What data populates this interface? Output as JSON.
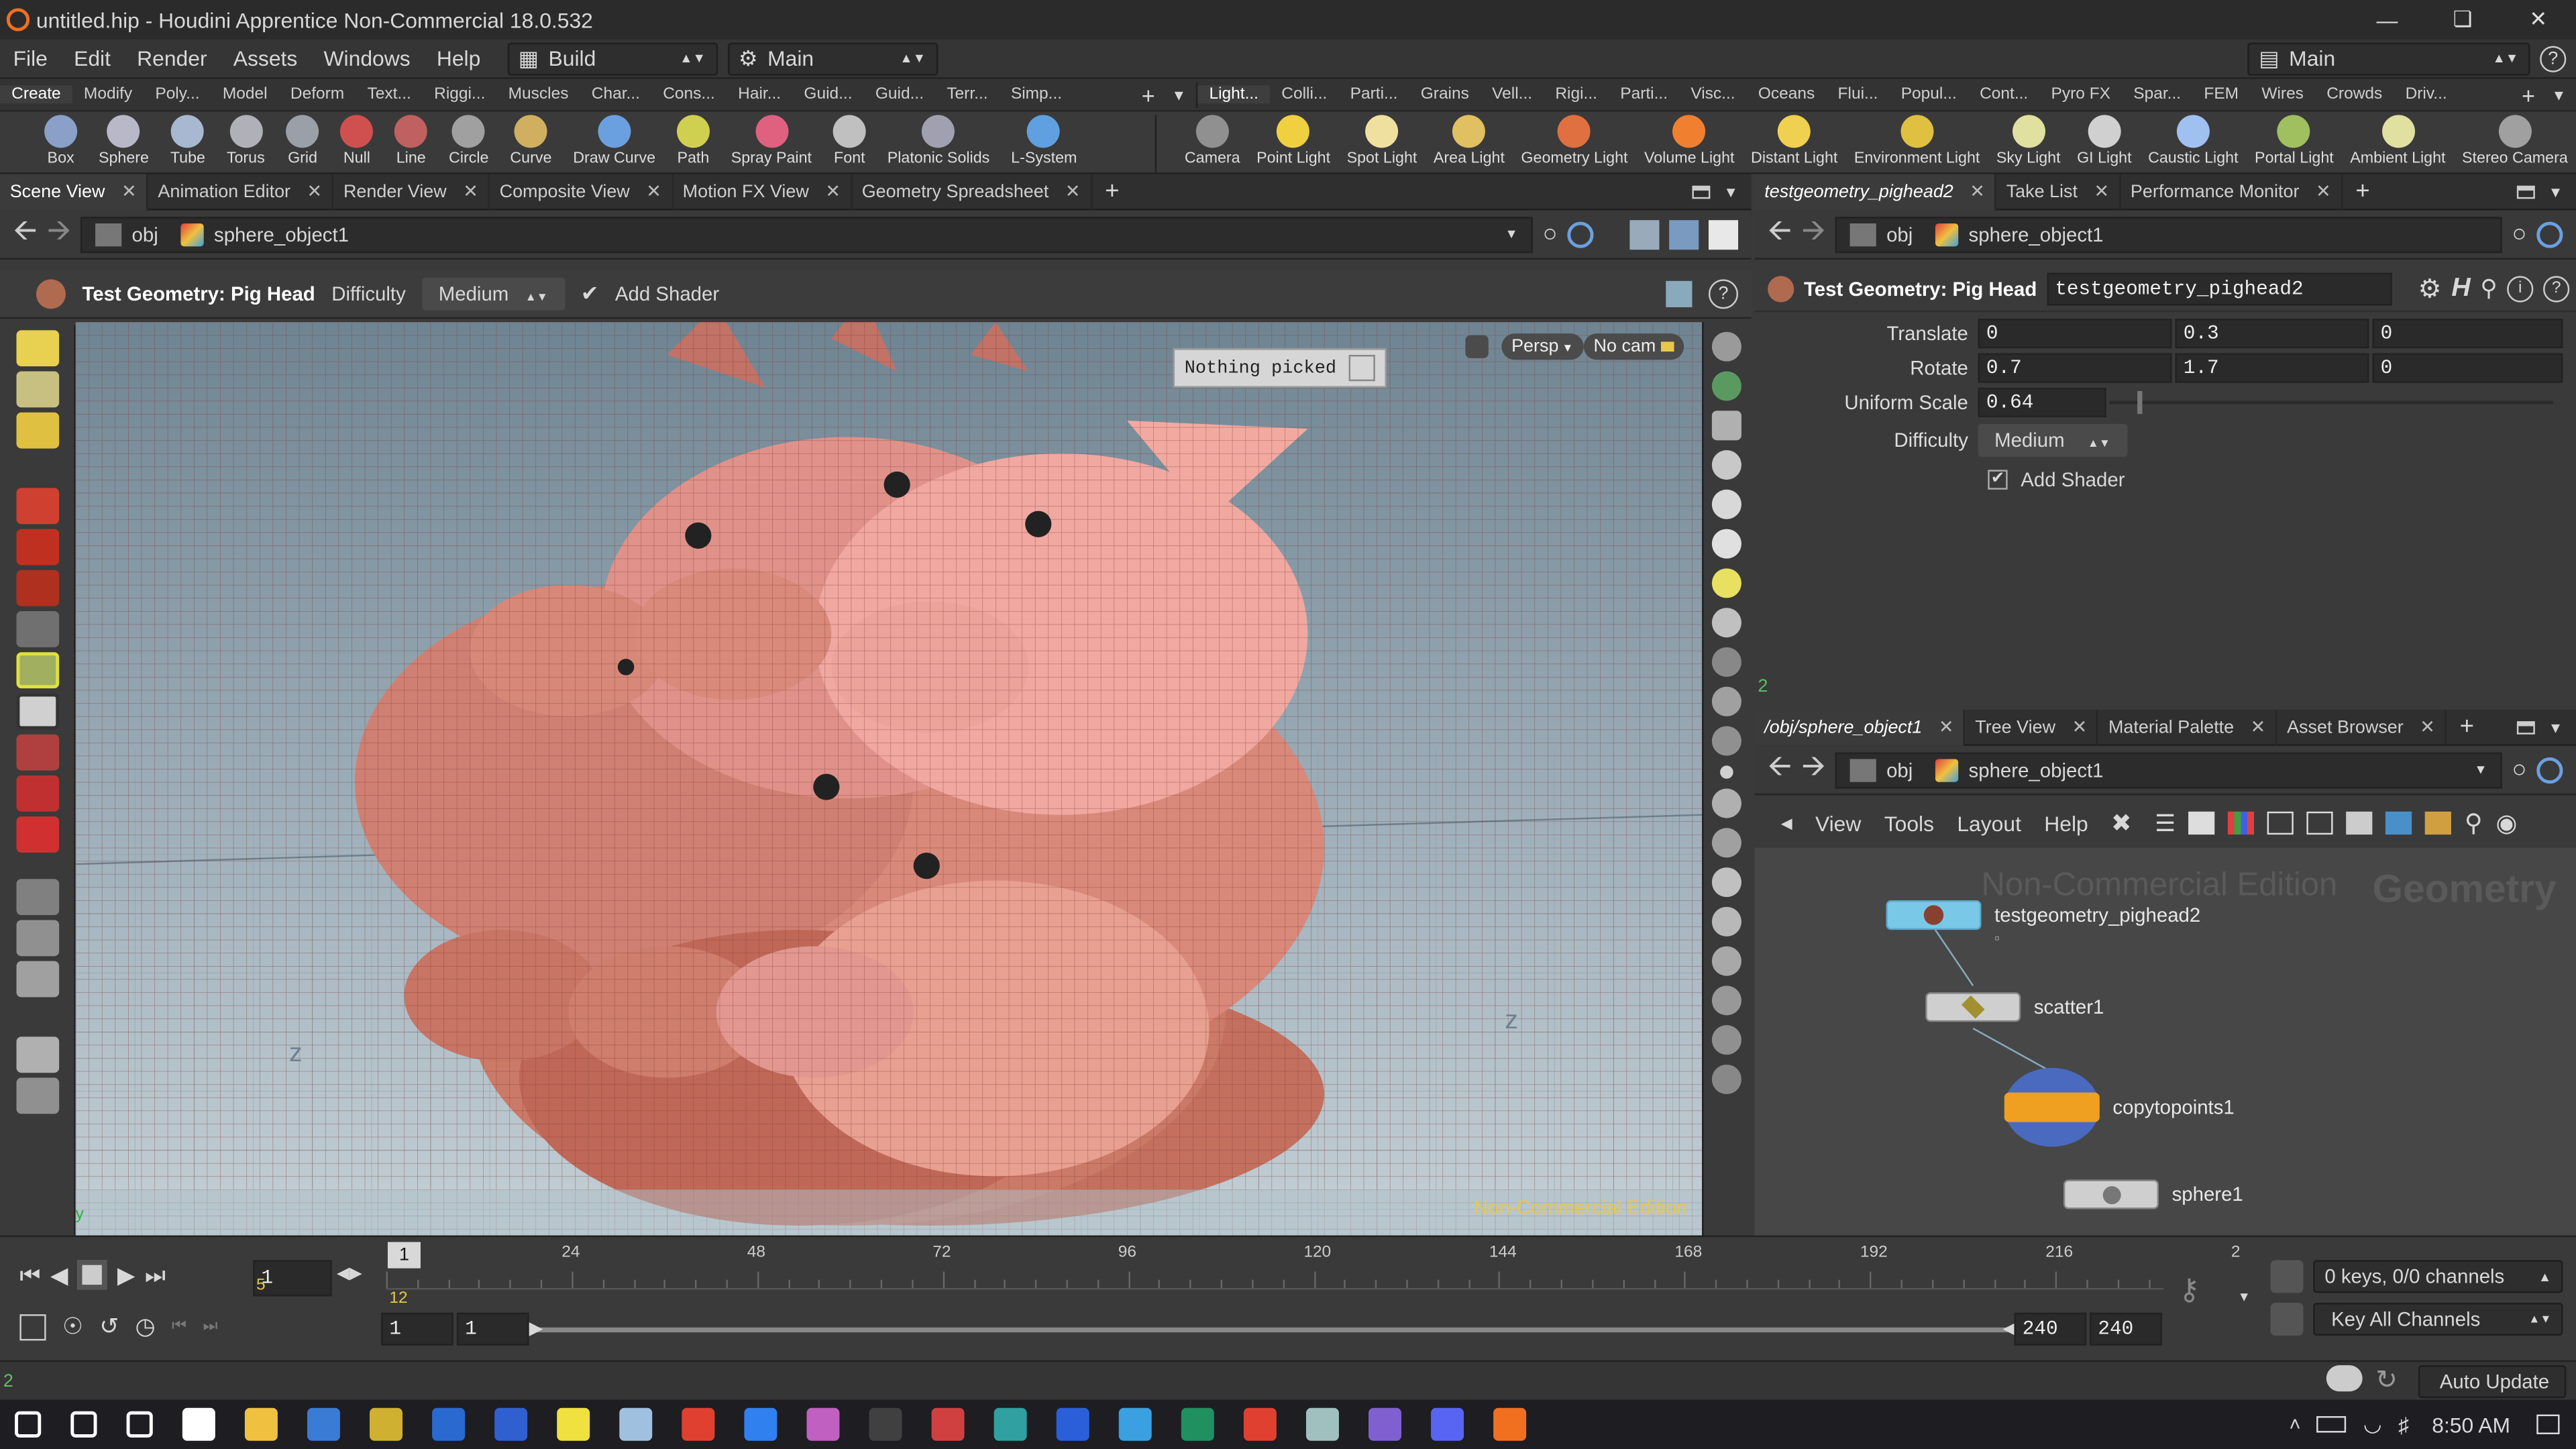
{
  "window": {
    "title": "untitled.hip - Houdini Apprentice Non-Commercial 18.0.532",
    "min_icon": "minimize-icon",
    "max_icon": "maximize-icon",
    "close_icon": "close-icon"
  },
  "menu": {
    "items": [
      "File",
      "Edit",
      "Render",
      "Assets",
      "Windows",
      "Help"
    ],
    "desktop_left": "Build",
    "desktop_mid": "Main",
    "desktop_right": "Main"
  },
  "shelf_tabs_left": [
    "Create",
    "Modify",
    "Poly...",
    "Model",
    "Deform",
    "Text...",
    "Riggi...",
    "Muscles",
    "Char...",
    "Cons...",
    "Hair...",
    "Guid...",
    "Guid...",
    "Terr...",
    "Simp..."
  ],
  "shelf_tabs_right": [
    "Light...",
    "Colli...",
    "Parti...",
    "Grains",
    "Vell...",
    "Rigi...",
    "Parti...",
    "Visc...",
    "Oceans",
    "Flui...",
    "Popul...",
    "Cont...",
    "Pyro FX",
    "Spar...",
    "FEM",
    "Wires",
    "Crowds",
    "Driv..."
  ],
  "tools_left": [
    {
      "label": "Box",
      "color": "#8aa0c8"
    },
    {
      "label": "Sphere",
      "color": "#b8b8c8"
    },
    {
      "label": "Tube",
      "color": "#a8b8d0"
    },
    {
      "label": "Torus",
      "color": "#b0b0b8"
    },
    {
      "label": "Grid",
      "color": "#9aa0a8"
    },
    {
      "label": "Null",
      "color": "#d05050"
    },
    {
      "label": "Line",
      "color": "#c06060"
    },
    {
      "label": "Circle",
      "color": "#a0a0a0"
    },
    {
      "label": "Curve",
      "color": "#d0b060"
    },
    {
      "label": "Draw Curve",
      "color": "#6aa0e0"
    },
    {
      "label": "Path",
      "color": "#d0d050"
    },
    {
      "label": "Spray Paint",
      "color": "#e06080"
    },
    {
      "label": "Font",
      "color": "#c0c0c0"
    },
    {
      "label": "Platonic Solids",
      "color": "#a0a0b0"
    },
    {
      "label": "L-System",
      "color": "#60a0e0"
    }
  ],
  "tools_right": [
    {
      "label": "Camera",
      "color": "#909090"
    },
    {
      "label": "Point Light",
      "color": "#f0d040"
    },
    {
      "label": "Spot Light",
      "color": "#f0e0a0"
    },
    {
      "label": "Area Light",
      "color": "#e0c060"
    },
    {
      "label": "Geometry Light",
      "color": "#e07040"
    },
    {
      "label": "Volume Light",
      "color": "#f08030"
    },
    {
      "label": "Distant Light",
      "color": "#f0d050"
    },
    {
      "label": "Environment Light",
      "color": "#e0c040"
    },
    {
      "label": "Sky Light",
      "color": "#e0e0a0"
    },
    {
      "label": "GI Light",
      "color": "#d0d0d0"
    },
    {
      "label": "Caustic Light",
      "color": "#a0c0f0"
    },
    {
      "label": "Portal Light",
      "color": "#a0c060"
    },
    {
      "label": "Ambient Light",
      "color": "#e0e0a0"
    },
    {
      "label": "Stereo Camera",
      "color": "#a0a0a0"
    }
  ],
  "left_pane_tabs": [
    "Scene View",
    "Animation Editor",
    "Render View",
    "Composite View",
    "Motion FX View",
    "Geometry Spreadsheet"
  ],
  "right_top_tabs": [
    "testgeometry_pighead2",
    "Take List",
    "Performance Monitor"
  ],
  "right_bottom_tabs": [
    "/obj/sphere_object1",
    "Tree View",
    "Material Palette",
    "Asset Browser"
  ],
  "path": {
    "context": "obj",
    "object": "sphere_object1"
  },
  "opbar": {
    "title": "Test Geometry: Pig Head",
    "difficulty_label": "Difficulty",
    "difficulty_value": "Medium",
    "shader_label": "Add Shader"
  },
  "viewport": {
    "picked": "Nothing picked",
    "persp": "Persp",
    "cam": "No cam",
    "nce": "Non-Commercial Edition"
  },
  "params": {
    "header_type": "Test Geometry: Pig Head",
    "header_name": "testgeometry_pighead2",
    "translate_label": "Translate",
    "translate": [
      "0",
      "0.3",
      "0"
    ],
    "rotate_label": "Rotate",
    "rotate": [
      "0.7",
      "1.7",
      "0"
    ],
    "scale_label": "Uniform Scale",
    "scale": "0.64",
    "scale_fraction": 0.064,
    "difficulty_label": "Difficulty",
    "difficulty": "Medium",
    "shader_label": "Add Shader",
    "footer_num": "2"
  },
  "network": {
    "menu": [
      "View",
      "Tools",
      "Layout",
      "Help"
    ],
    "watermark": "Non-Commercial Edition",
    "context_label": "Geometry",
    "nodes": [
      "testgeometry_pighead2",
      "scatter1",
      "copytopoints1",
      "sphere1"
    ]
  },
  "timeline": {
    "ticks": [
      "24",
      "48",
      "72",
      "96",
      "120",
      "144",
      "168",
      "192",
      "216",
      "2"
    ],
    "current_frame": "1",
    "frame_field": "1",
    "range_start": "1",
    "range_start2": "1",
    "range_end": "240",
    "range_end2": "240",
    "keys": "0 keys, 0/0 channels",
    "key_all": "Key All Channels",
    "auto_update": "Auto Update",
    "fps_top": "5",
    "fps_bottom": "12",
    "status_num": "2"
  },
  "taskbar": {
    "time": "8:50 AM",
    "icons": [
      "start-icon",
      "search-icon",
      "task-view-icon",
      "store-icon",
      "explorer-icon",
      "app-icon",
      "app-icon",
      "app-icon",
      "calculator-icon",
      "sticky-notes-icon",
      "app-icon",
      "chrome-icon",
      "maps-icon",
      "app-icon",
      "terminal-icon",
      "app-icon",
      "app-icon",
      "word-icon",
      "edge-icon",
      "app-icon",
      "chrome-icon",
      "app-icon",
      "visual-studio-icon",
      "discord-icon",
      "houdini-icon"
    ],
    "colors": [
      "#ffffff",
      "#ffffff",
      "#ffffff",
      "#ffffff",
      "#f0c040",
      "#3a7bd5",
      "#d0b030",
      "#2a6ad0",
      "#3060d0",
      "#f0e040",
      "#a0c0e0",
      "#e04030",
      "#3080f0",
      "#c060c0",
      "#404040",
      "#d04040",
      "#30a0a0",
      "#2b5fd9",
      "#3aa0e0",
      "#209060",
      "#e04030",
      "#a0c0c0",
      "#8060d0",
      "#5865f2",
      "#f07020"
    ]
  }
}
